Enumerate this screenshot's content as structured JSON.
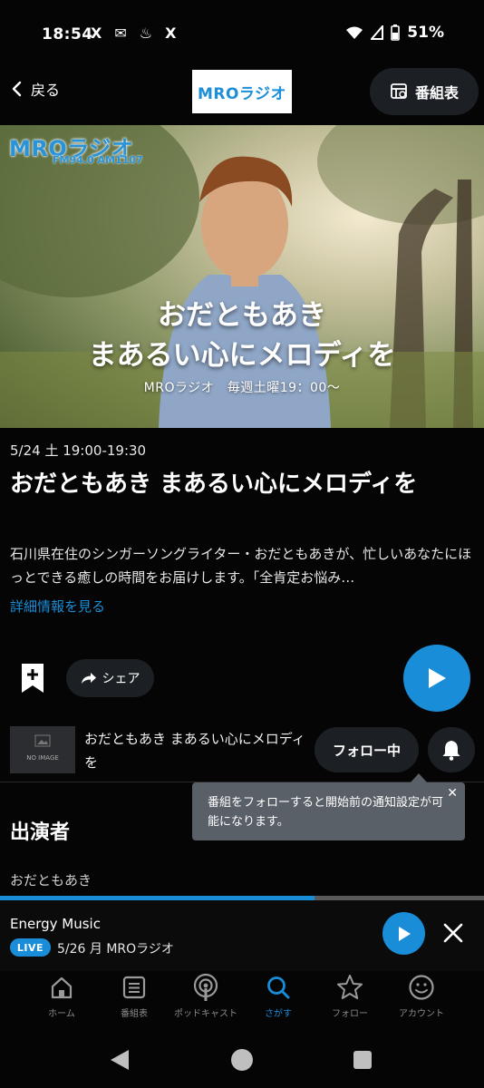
{
  "status_bar": {
    "time": "18:54",
    "notif_icons": [
      "X",
      "✉",
      "♨",
      "X"
    ],
    "battery": "51%"
  },
  "header": {
    "back_label": "戻る",
    "logo_text": "MROラジオ",
    "schedule_label": "番組表"
  },
  "hero": {
    "logo_text": "MROラジオ",
    "freq_text": "FM94.0 AM1107",
    "title_line1": "おだともあき",
    "title_line2": "まあるい心にメロディを",
    "subtitle": "MROラジオ　毎週土曜19：00〜"
  },
  "program": {
    "date_time": "5/24 土 19:00-19:30",
    "title": "おだともあき まあるい心にメロディを",
    "description": "石川県在住のシンガーソングライター・おだともあきが、忙しいあなたにほっとできる癒しの時間をお届けします。「全肯定お悩み…",
    "detail_link": "詳細情報を見る"
  },
  "actions": {
    "share_label": "シェア"
  },
  "follow_row": {
    "noimage_label": "NO IMAGE",
    "title": "おだともあき まあるい心にメロディを",
    "follow_label": "フォロー中"
  },
  "tooltip": {
    "text": "番組をフォローすると開始前の通知設定が可能になります。",
    "close": "✕"
  },
  "cast": {
    "heading": "出演者",
    "names": [
      "おだともあき"
    ]
  },
  "player": {
    "progress": 0.65,
    "title": "Energy Music",
    "live_badge": "LIVE",
    "meta": "5/26 月 MROラジオ"
  },
  "bottom_nav": {
    "items": [
      {
        "label": "ホーム",
        "icon": "home-icon"
      },
      {
        "label": "番組表",
        "icon": "schedule-icon"
      },
      {
        "label": "ポッドキャスト",
        "icon": "podcast-icon"
      },
      {
        "label": "さがす",
        "icon": "search-icon"
      },
      {
        "label": "フォロー",
        "icon": "star-icon"
      },
      {
        "label": "アカウント",
        "icon": "account-icon"
      }
    ],
    "active_index": 3
  },
  "colors": {
    "accent": "#1a8dd8",
    "background": "#050505",
    "pill": "#1c1f24"
  }
}
